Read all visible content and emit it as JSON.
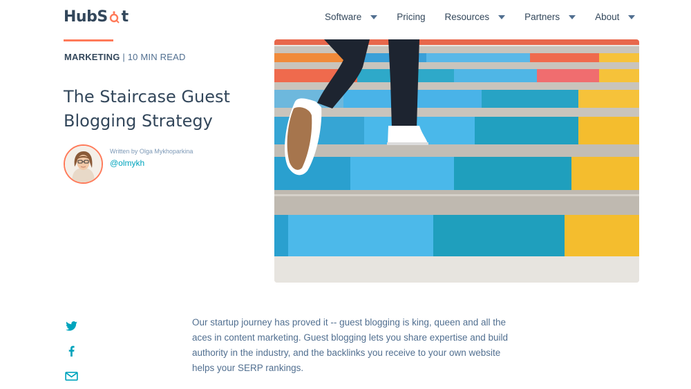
{
  "brand": {
    "name_head": "HubS",
    "name_tail": "t",
    "accent_color": "#ff7a59",
    "text_color": "#33475b",
    "link_color": "#00a4bd"
  },
  "nav": {
    "items": [
      {
        "label": "Software",
        "has_dropdown": true
      },
      {
        "label": "Pricing",
        "has_dropdown": false
      },
      {
        "label": "Resources",
        "has_dropdown": true
      },
      {
        "label": "Partners",
        "has_dropdown": true
      },
      {
        "label": "About",
        "has_dropdown": true
      }
    ]
  },
  "article": {
    "category": "MARKETING",
    "separator": " | ",
    "read_time": "10 MIN READ",
    "title": "The Staircase Guest Blogging Strategy",
    "author_byline": "Written by Olga Mykhoparkina",
    "author_handle": "@olmykh",
    "intro": "Our startup journey has proved it -- guest blogging is king, queen and all the aces in content marketing. Guest blogging lets you share expertise and build authority in the industry, and the backlinks you receive to your own website helps your SERP rankings."
  },
  "social": {
    "icons": [
      "twitter-icon",
      "facebook-icon",
      "email-icon"
    ]
  }
}
